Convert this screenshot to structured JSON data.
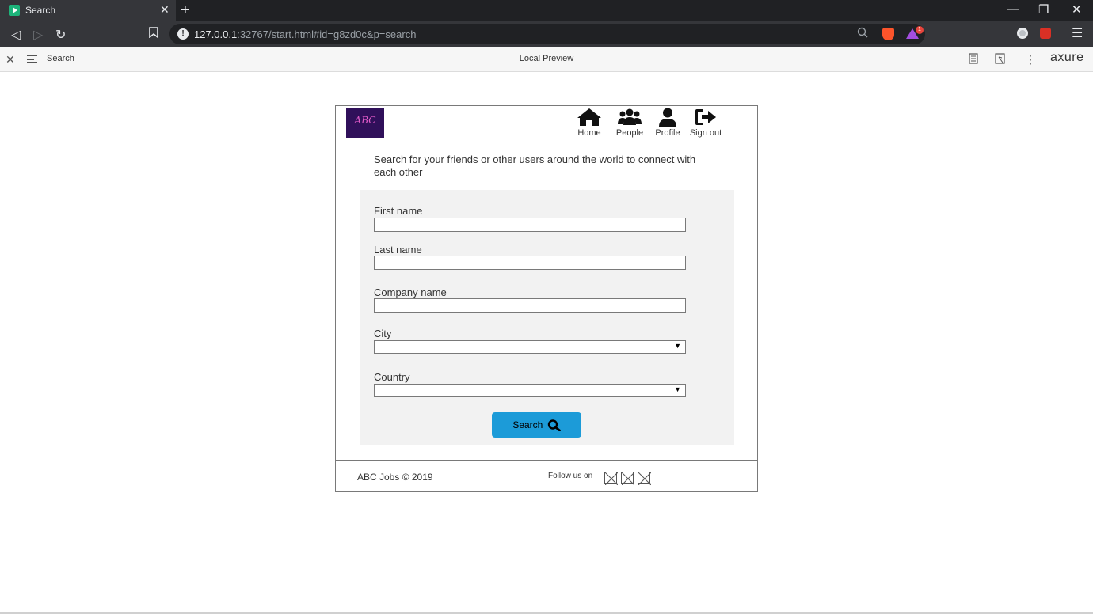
{
  "browser": {
    "tab_title": "Search",
    "url_host": "127.0.0.1",
    "url_rest": ":32767/start.html#id=g8zd0c&p=search",
    "rewards_count": "1"
  },
  "axure_bar": {
    "page_name": "Search",
    "mode": "Local Preview",
    "brand": "axure"
  },
  "header": {
    "logo_text": "ABC",
    "nav": [
      {
        "label": "Home"
      },
      {
        "label": "People"
      },
      {
        "label": "Profile"
      },
      {
        "label": "Sign out"
      }
    ]
  },
  "main": {
    "intro": "Search for your friends or other users around the world to connect with each other"
  },
  "form": {
    "first_name_label": "First name",
    "first_name_value": "",
    "last_name_label": "Last name",
    "last_name_value": "",
    "company_label": "Company name",
    "company_value": "",
    "city_label": "City",
    "city_value": "",
    "country_label": "Country",
    "country_value": "",
    "search_button": "Search"
  },
  "footer": {
    "copyright": "ABC Jobs  © 2019",
    "follow": "Follow us on"
  },
  "colors": {
    "accent": "#1c9bd8",
    "logo_bg": "#30105a",
    "form_bg": "#f2f2f2"
  }
}
